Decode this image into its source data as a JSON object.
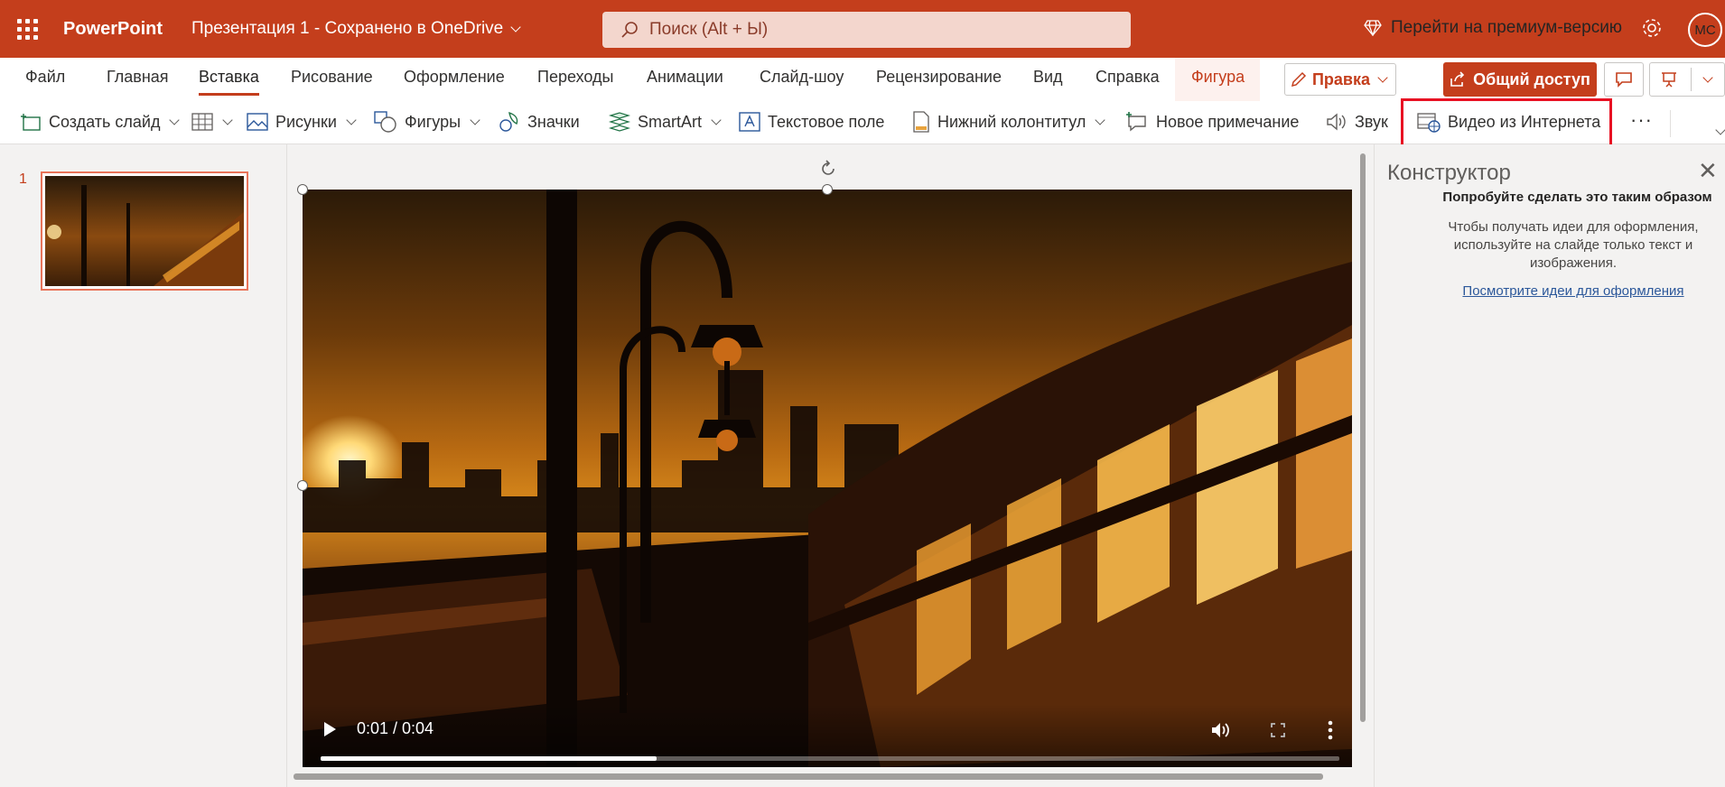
{
  "titlebar": {
    "app_name": "PowerPoint",
    "doc_title": "Презентация 1 - Сохранено в OneDrive",
    "search_placeholder": "Поиск (Alt + Ы)",
    "premium_label": "Перейти на премиум-версию",
    "avatar_initials": "МС",
    "brand_color": "#c43e1c"
  },
  "tabs": [
    {
      "label": "Файл"
    },
    {
      "label": "Главная"
    },
    {
      "label": "Вставка",
      "active": true
    },
    {
      "label": "Рисование"
    },
    {
      "label": "Оформление"
    },
    {
      "label": "Переходы"
    },
    {
      "label": "Анимации"
    },
    {
      "label": "Слайд-шоу"
    },
    {
      "label": "Рецензирование"
    },
    {
      "label": "Вид"
    },
    {
      "label": "Справка"
    },
    {
      "label": "Фигура",
      "contextual": true
    }
  ],
  "actions": {
    "edit_label": "Правка",
    "share_label": "Общий доступ"
  },
  "ribbon": {
    "new_slide": "Создать слайд",
    "pictures": "Рисунки",
    "shapes": "Фигуры",
    "icons": "Значки",
    "smartart": "SmartArt",
    "textbox": "Текстовое поле",
    "footer": "Нижний колонтитул",
    "new_comment": "Новое примечание",
    "audio": "Звук",
    "online_video": "Видео из Интернета",
    "more": "···"
  },
  "slides": [
    {
      "number": "1",
      "selected": true
    }
  ],
  "video": {
    "time": "0:01 / 0:04",
    "progress": 0.33
  },
  "designer": {
    "title": "Конструктор",
    "subtitle": "Попробуйте сделать это таким образом",
    "body": "Чтобы получать идеи для оформления, используйте на слайде только текст и изображения.",
    "link": "Посмотрите идеи для оформления"
  }
}
